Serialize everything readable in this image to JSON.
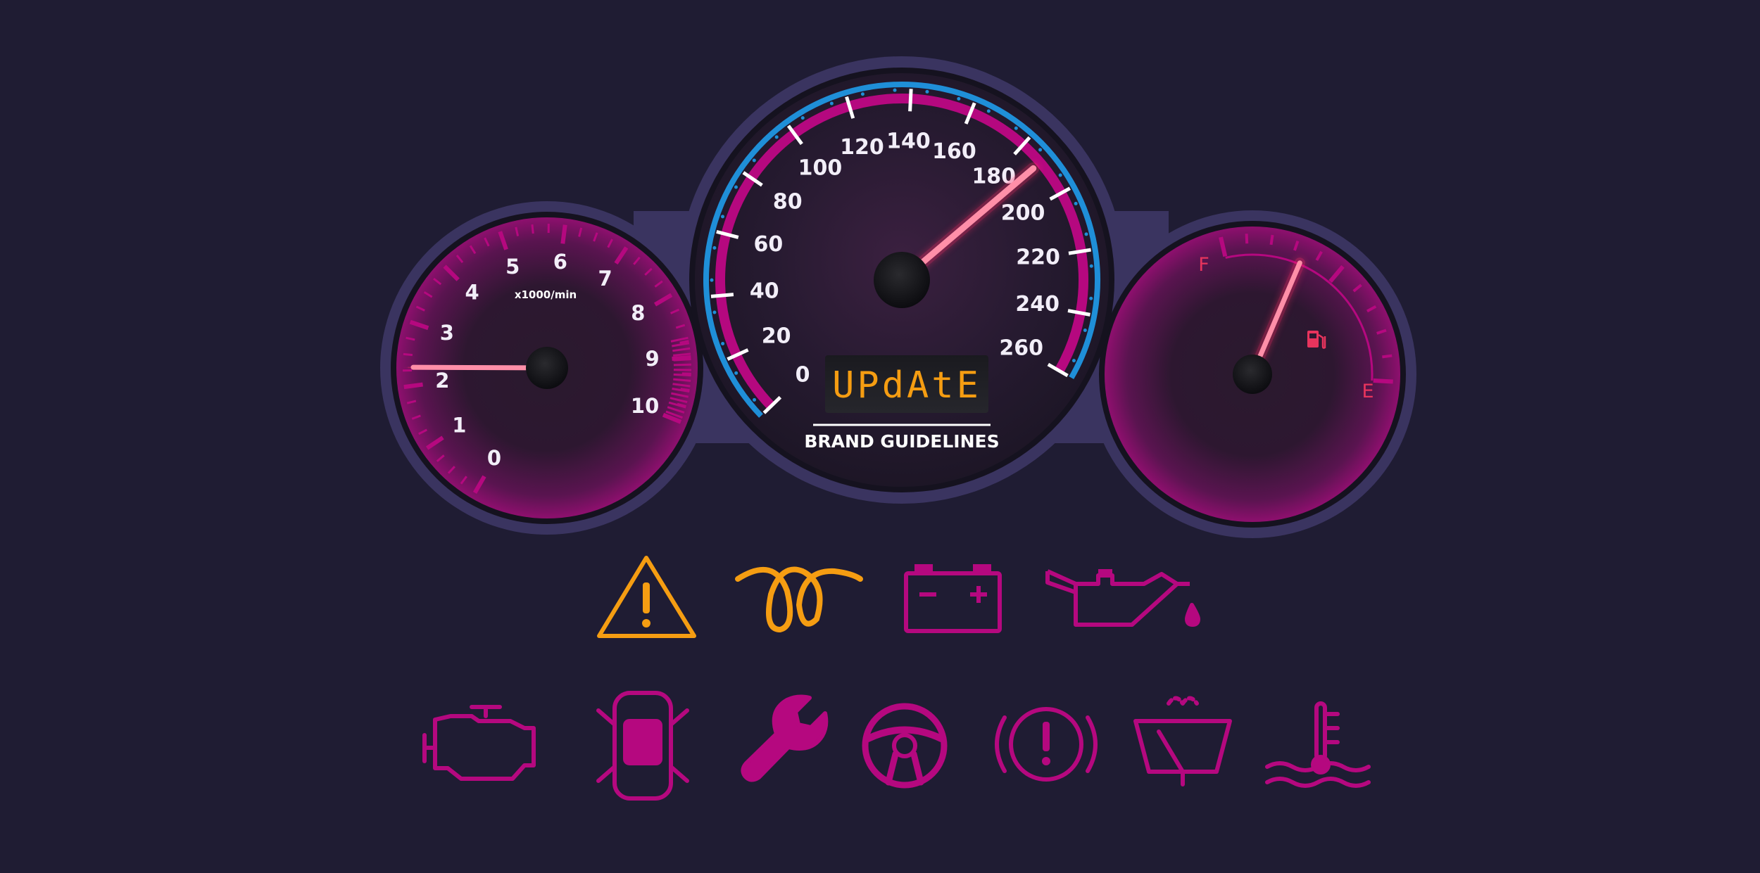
{
  "colors": {
    "background": "#1f1c33",
    "bezel": "#3b3563",
    "magenta": "#b5087f",
    "blue_ring": "#1f8fd8",
    "needle": "#ff5a7e",
    "amber": "#f59d12",
    "fuel_red": "#e8345d"
  },
  "tachometer": {
    "unit_label": "x1000/min",
    "tick_labels": [
      "0",
      "1",
      "2",
      "3",
      "4",
      "5",
      "6",
      "7",
      "8",
      "9",
      "10"
    ],
    "reading": 2.3
  },
  "speedometer": {
    "tick_labels": [
      "0",
      "20",
      "40",
      "60",
      "80",
      "100",
      "120",
      "140",
      "160",
      "180",
      "200",
      "220",
      "240",
      "260"
    ],
    "reading": 188,
    "display_text": "UPdAtE",
    "brand_text": "BRAND GUIDELINES"
  },
  "fuel_gauge": {
    "full_label": "F",
    "empty_label": "E",
    "level_percent": 66,
    "icon": "fuel-pump-icon"
  },
  "warning_lights": {
    "row1": [
      "hazard-warning-icon",
      "glow-plug-icon",
      "battery-icon",
      "oil-pressure-icon"
    ],
    "row2": [
      "check-engine-icon",
      "door-open-icon",
      "service-wrench-icon",
      "steering-wheel-icon",
      "brake-warning-icon",
      "windshield-washer-icon",
      "coolant-temperature-icon"
    ]
  }
}
